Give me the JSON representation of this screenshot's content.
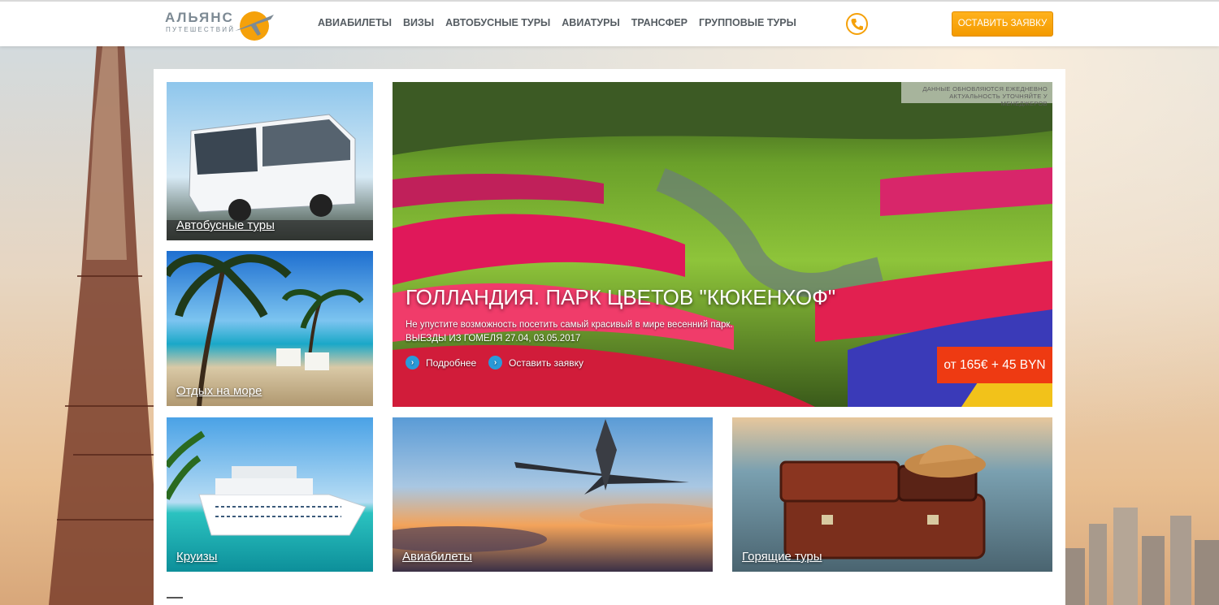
{
  "header": {
    "logo_main": "АЛЬЯНС",
    "logo_sub": "ПУТЕШЕСТВИЙ",
    "nav": [
      "АВИАБИЛЕТЫ",
      "ВИЗЫ",
      "АВТОБУСНЫЕ ТУРЫ",
      "АВИАТУРЫ",
      "ТРАНСФЕР",
      "ГРУППОВЫЕ ТУРЫ"
    ],
    "cta_label": "ОСТАВИТЬ ЗАЯВКУ",
    "icons": {
      "logo": "plane-logo-icon",
      "phone": "phone-icon"
    }
  },
  "tiles": {
    "bus": "Автобусные туры",
    "sea": "Отдых на море",
    "cruise": "Круизы",
    "air": "Авиабилеты",
    "hot": "Горящие туры"
  },
  "hero": {
    "notice_line1": "ДАННЫЕ ОБНОВЛЯЮТСЯ ЕЖЕДНЕВНО",
    "notice_line2": "АКТУАЛЬНОСТЬ УТОЧНЯЙТЕ У МЕНЕДЖЕРОВ",
    "title": "ГОЛЛАНДИЯ. ПАРК ЦВЕТОВ \"КЮКЕНХОФ\"",
    "description": "Не упустите возможность посетить самый красивый в мире весенний парк.",
    "dates": "ВЫЕЗДЫ ИЗ ГОМЕЛЯ 27.04, 03.05.2017",
    "link_more": "Подробнее",
    "link_order": "Оставить заявку",
    "price": "от 165€ + 45 BYN"
  },
  "colors": {
    "accent_orange": "#f5a10a",
    "price_red": "#ee3a12",
    "link_blue": "#2a9ad9",
    "nav_text": "#555c62"
  }
}
